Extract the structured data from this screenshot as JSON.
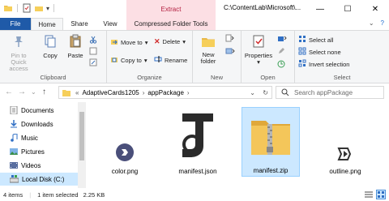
{
  "titlebar": {
    "contextual_tab": "Extract",
    "path": "C:\\ContentLab\\Microsoft\\...",
    "minimize": "—",
    "maximize": "☐",
    "close": "✕"
  },
  "tabs": {
    "file": "File",
    "home": "Home",
    "share": "Share",
    "view": "View",
    "compressed": "Compressed Folder Tools"
  },
  "ribbon": {
    "clipboard": {
      "pin": "Pin to Quick access",
      "copy": "Copy",
      "paste": "Paste",
      "label": "Clipboard"
    },
    "organize": {
      "move_to": "Move to",
      "copy_to": "Copy to",
      "delete": "Delete",
      "rename": "Rename",
      "label": "Organize"
    },
    "new": {
      "new_folder": "New folder",
      "label": "New"
    },
    "open": {
      "properties": "Properties",
      "label": "Open"
    },
    "select": {
      "select_all": "Select all",
      "select_none": "Select none",
      "invert": "Invert selection",
      "label": "Select"
    }
  },
  "address": {
    "prefix": "«",
    "segments": [
      "AdaptiveCards1205",
      "appPackage"
    ],
    "search_placeholder": "Search appPackage"
  },
  "nav": {
    "items": [
      {
        "label": "Documents",
        "icon": "documents-icon"
      },
      {
        "label": "Downloads",
        "icon": "downloads-icon"
      },
      {
        "label": "Music",
        "icon": "music-icon"
      },
      {
        "label": "Pictures",
        "icon": "pictures-icon"
      },
      {
        "label": "Videos",
        "icon": "videos-icon"
      },
      {
        "label": "Local Disk (C:)",
        "icon": "drive-icon"
      }
    ]
  },
  "files": [
    {
      "name": "color.png",
      "icon": "image-file-icon"
    },
    {
      "name": "manifest.json",
      "icon": "json-file-icon"
    },
    {
      "name": "manifest.zip",
      "icon": "zip-folder-icon"
    },
    {
      "name": "outline.png",
      "icon": "image-file-icon"
    }
  ],
  "status": {
    "count": "4 items",
    "selected": "1 item selected",
    "size": "2.25 KB"
  },
  "colors": {
    "file_tab": "#1f5aa8",
    "contextual": "#fcdfe4",
    "selection": "#cce8ff"
  }
}
